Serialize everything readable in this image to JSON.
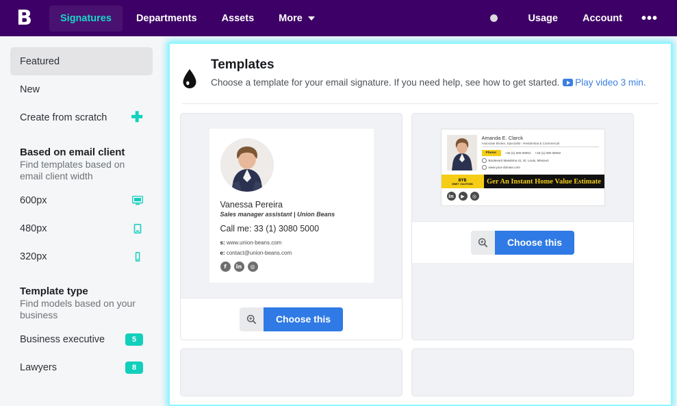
{
  "navbar": {
    "logo": "B",
    "logo_icon": "brand-b-logo",
    "items": [
      {
        "label": "Signatures",
        "active": true
      },
      {
        "label": "Departments",
        "active": false
      },
      {
        "label": "Assets",
        "active": false
      },
      {
        "label": "More",
        "active": false,
        "caret": true
      }
    ],
    "right_items": [
      {
        "label": "Usage"
      },
      {
        "label": "Account"
      }
    ],
    "status_dot": "status-dot-icon",
    "overflow": "•••"
  },
  "sidebar": {
    "nav": [
      {
        "label": "Featured",
        "selected": true
      },
      {
        "label": "New",
        "selected": false
      },
      {
        "label": "Create from scratch",
        "selected": false,
        "icon": "plus-icon",
        "glyph": "➕"
      }
    ],
    "email_client_group": {
      "title": "Based on email client",
      "subtitle": "Find templates based on email client width",
      "items": [
        {
          "label": "600px",
          "icon": "desktop-icon"
        },
        {
          "label": "480px",
          "icon": "tablet-icon"
        },
        {
          "label": "320px",
          "icon": "mobile-icon"
        }
      ]
    },
    "template_type_group": {
      "title": "Template type",
      "subtitle": "Find models based on your business",
      "items": [
        {
          "label": "Business executive",
          "count": "5"
        },
        {
          "label": "Lawyers",
          "count": "8"
        }
      ]
    }
  },
  "panel": {
    "icon": "water-drop-icon",
    "title": "Templates",
    "description_part1": "Choose a template for your email signature. If you need help, see how to get started. ",
    "link_text": "Play video 3 min.",
    "video_icon": "youtube-play-icon"
  },
  "cards": [
    {
      "id": "template-card-vanessa-pereira",
      "zoom_icon": "magnify-plus-icon",
      "choose_label": "Choose this",
      "signature": {
        "style": "sig1",
        "photo": "portrait-photo",
        "name": "Vanessa Pereira",
        "role": "Sales manager assistant | Union Beans",
        "call": "Call me: 33 (1) 3080 5000",
        "site_label": "s:",
        "site": "www.union-beans.com",
        "email_label": "e:",
        "email": "contact@union-beans.com",
        "socials": [
          {
            "icon": "facebook-icon",
            "glyph": "f"
          },
          {
            "icon": "linkedin-icon",
            "glyph": "in"
          },
          {
            "icon": "instagram-icon",
            "glyph": "◎"
          }
        ]
      }
    },
    {
      "id": "template-card-amanda-clarck",
      "zoom_icon": "magnify-plus-icon",
      "choose_label": "Choose this",
      "signature": {
        "style": "sig2",
        "photo": "portrait-photo",
        "name": "Amanda E. Clarck",
        "role": "Associate Broker, Specialist - Residential & Commercial",
        "phone_label": "Phone:",
        "phone1": "+33 (1) 000 00001",
        "phone2": "+33 (1) 000 00002",
        "address": "Boulevard Masséina 41, St. Louis, Missouri",
        "website": "www.your-domain.com",
        "banner_logo_top": "BYB",
        "banner_logo_bottom": "SMART SOLUTIONS",
        "banner_text": "Ger An Instant Home Value Estimate",
        "socials": [
          {
            "icon": "linkedin-icon",
            "glyph": "in"
          },
          {
            "icon": "youtube-icon",
            "glyph": "▶"
          },
          {
            "icon": "instagram-icon",
            "glyph": "◎"
          }
        ]
      }
    }
  ],
  "colors": {
    "nav_bg": "#3d0066",
    "accent_teal": "#12cfbc",
    "accent_cyan_glow": "#8ef6ff",
    "button_blue": "#2f7ae5",
    "link_blue": "#3b7fe0",
    "banner_yellow": "#f5cd17"
  }
}
